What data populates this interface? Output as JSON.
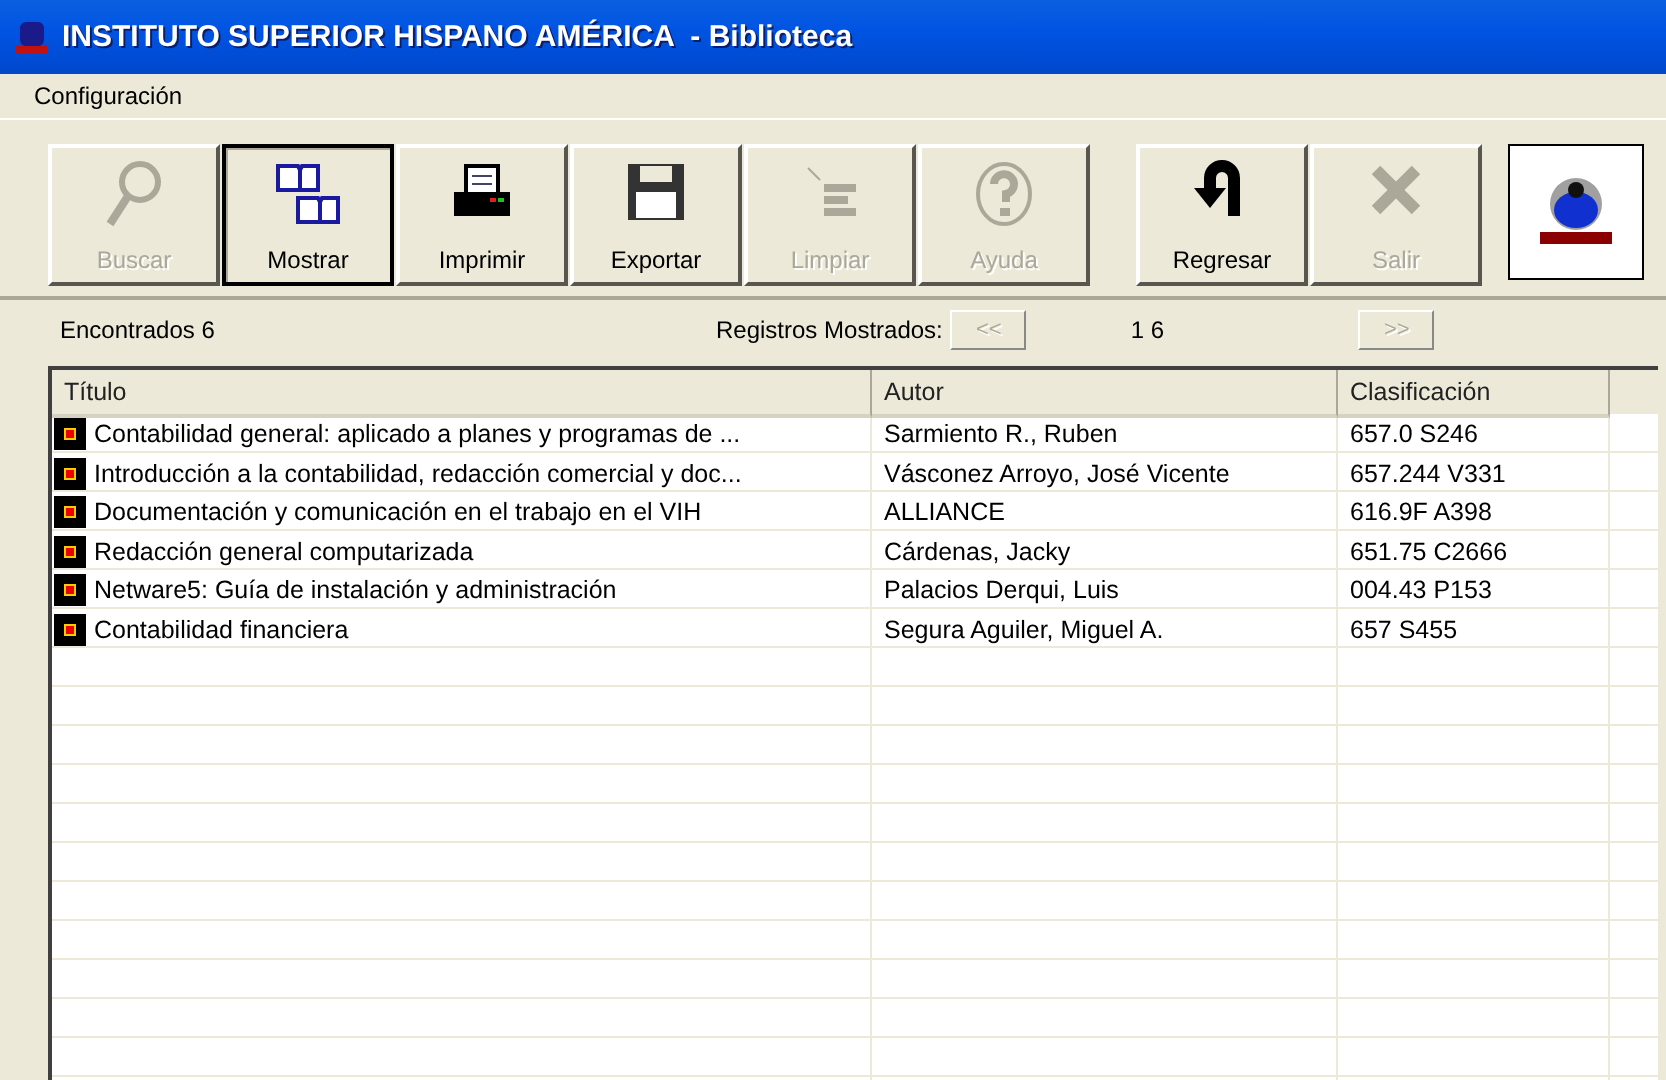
{
  "window": {
    "title": "INSTITUTO SUPERIOR HISPANO AMÉRICA  - Biblioteca"
  },
  "menu": [
    "Configuración"
  ],
  "toolbar": {
    "buttons": [
      {
        "label": "Buscar",
        "disabled": true,
        "selected": false
      },
      {
        "label": "Mostrar",
        "disabled": false,
        "selected": true
      },
      {
        "label": "Imprimir",
        "disabled": false,
        "selected": false
      },
      {
        "label": "Exportar",
        "disabled": false,
        "selected": false
      },
      {
        "label": "Limpiar",
        "disabled": true,
        "selected": false
      },
      {
        "label": "Ayuda",
        "disabled": true,
        "selected": false
      }
    ],
    "nav_buttons": [
      {
        "label": "Regresar",
        "disabled": false,
        "selected": false
      },
      {
        "label": "Salir",
        "disabled": true,
        "selected": false
      }
    ]
  },
  "results": {
    "found": "Encontrados 6",
    "shown_label": "Registros Mostrados:",
    "prev": "<<",
    "range": "1 6",
    "next": ">>",
    "prev_disabled": true,
    "next_disabled": true
  },
  "table": {
    "columns": [
      "Título",
      "Autor",
      "Clasificación"
    ],
    "rows": [
      [
        "Contabilidad general: aplicado a planes y programas de ...",
        "Sarmiento R., Ruben",
        "657.0 S246"
      ],
      [
        "Introducción a la contabilidad, redacción comercial y doc...",
        "Vásconez Arroyo, José Vicente",
        "657.244 V331"
      ],
      [
        "Documentación y comunicación en el trabajo en el VIH",
        "ALLIANCE",
        "616.9F A398"
      ],
      [
        "Redacción general computarizada",
        "Cárdenas, Jacky",
        "651.75 C2666"
      ],
      [
        "Netware5: Guía de instalación y administración",
        "Palacios Derqui, Luis",
        "004.43 P153"
      ],
      [
        "Contabilidad financiera",
        "Segura Aguiler, Miguel A.",
        "657 S455"
      ]
    ]
  }
}
